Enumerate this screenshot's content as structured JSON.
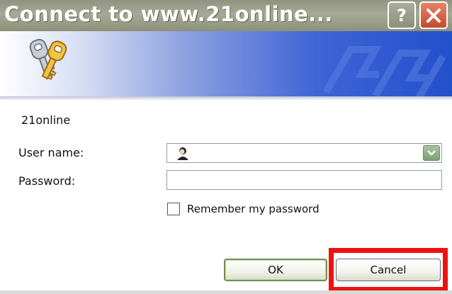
{
  "window": {
    "title": "Connect to www.21online...",
    "help_label": "?"
  },
  "icons": {
    "banner": "keys-icon",
    "help": "question-mark-icon",
    "close": "close-icon",
    "user": "user-avatar-icon",
    "dropdown": "chevron-down-icon"
  },
  "dialog": {
    "realm": "21online",
    "username_label": "User name:",
    "username_value": "",
    "password_label": "Password:",
    "password_value": "",
    "remember_label": "Remember my password",
    "remember_checked": false
  },
  "buttons": {
    "ok": "OK",
    "cancel": "Cancel"
  },
  "colors": {
    "titlebar": "#9a9e88",
    "banner_blue": "#2350cc",
    "highlight": "#ee1111",
    "close_red": "#c24b2f"
  }
}
